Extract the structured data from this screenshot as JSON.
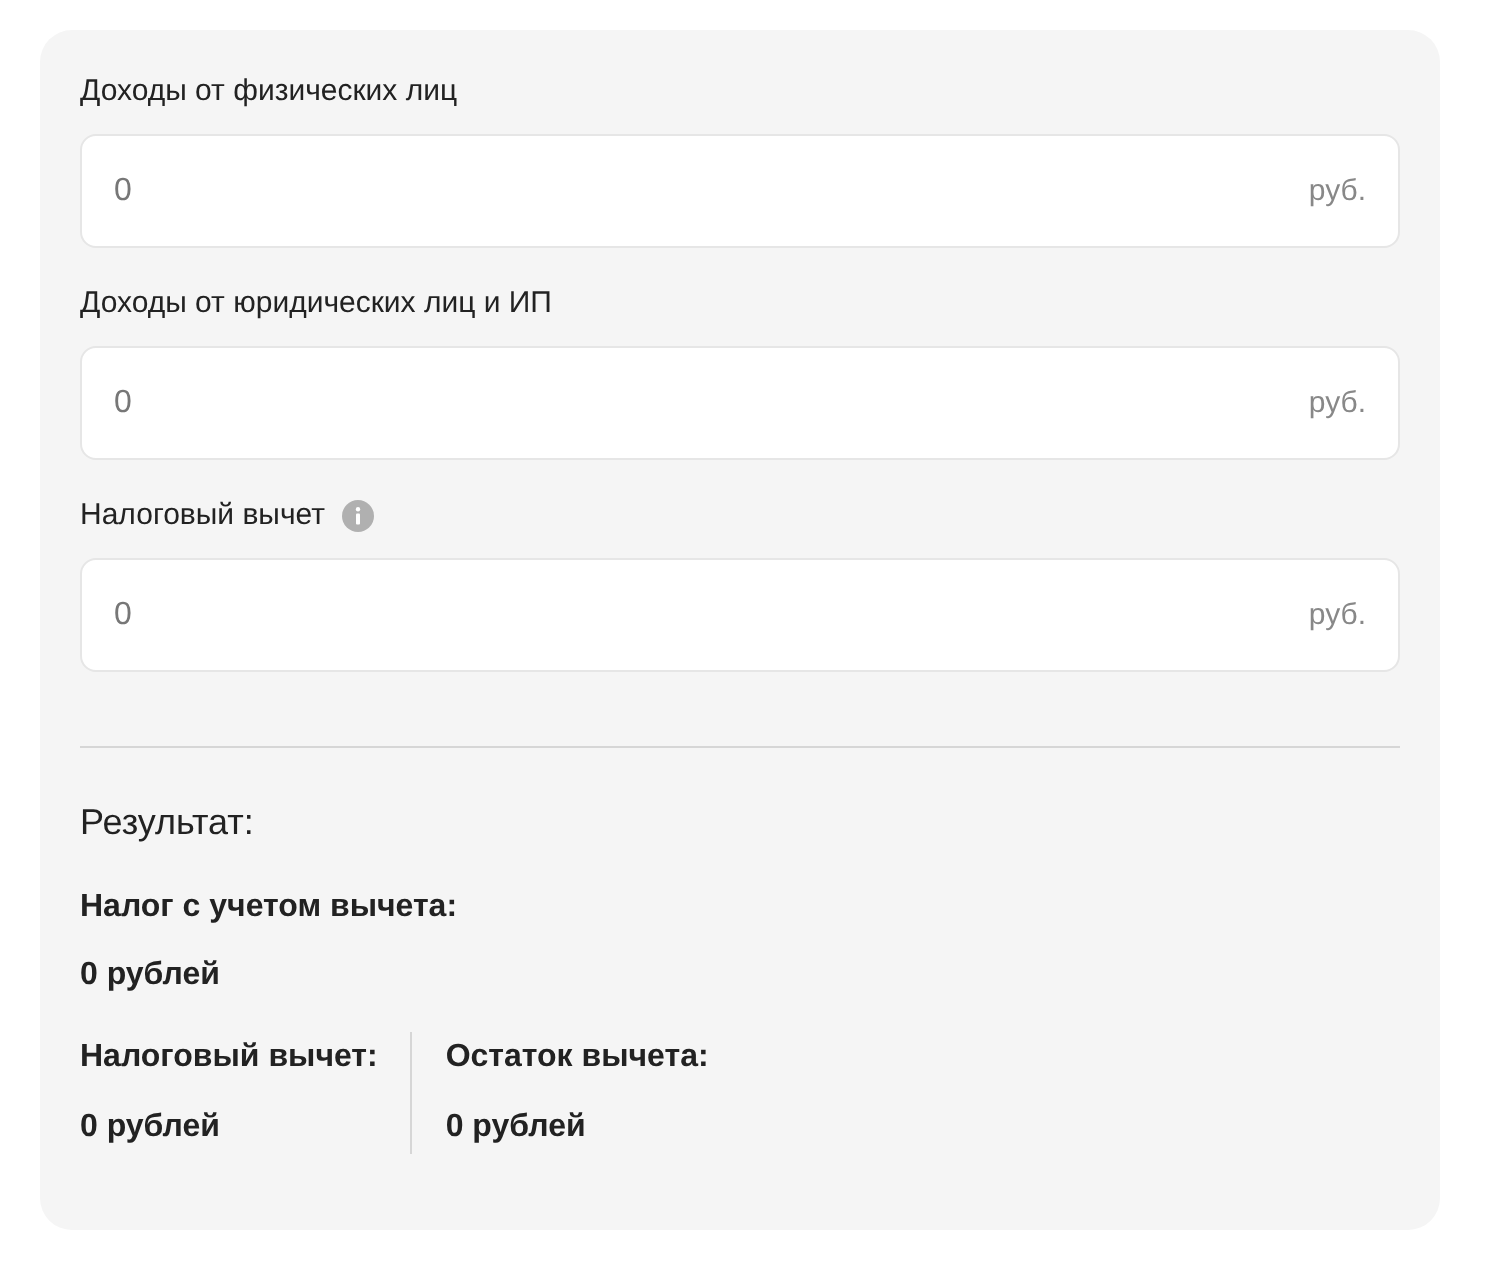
{
  "fields": [
    {
      "label": "Доходы от физических лиц",
      "value": "0",
      "unit": "руб.",
      "info": false
    },
    {
      "label": "Доходы от юридических лиц и ИП",
      "value": "0",
      "unit": "руб.",
      "info": false
    },
    {
      "label": "Налоговый вычет",
      "value": "0",
      "unit": "руб.",
      "info": true
    }
  ],
  "result": {
    "title": "Результат:",
    "tax": {
      "label": "Налог с учетом вычета:",
      "value": "0 рублей"
    },
    "columns": [
      {
        "label": "Налоговый вычет:",
        "value": "0 рублей"
      },
      {
        "label": "Остаток вычета:",
        "value": "0 рублей"
      }
    ]
  }
}
